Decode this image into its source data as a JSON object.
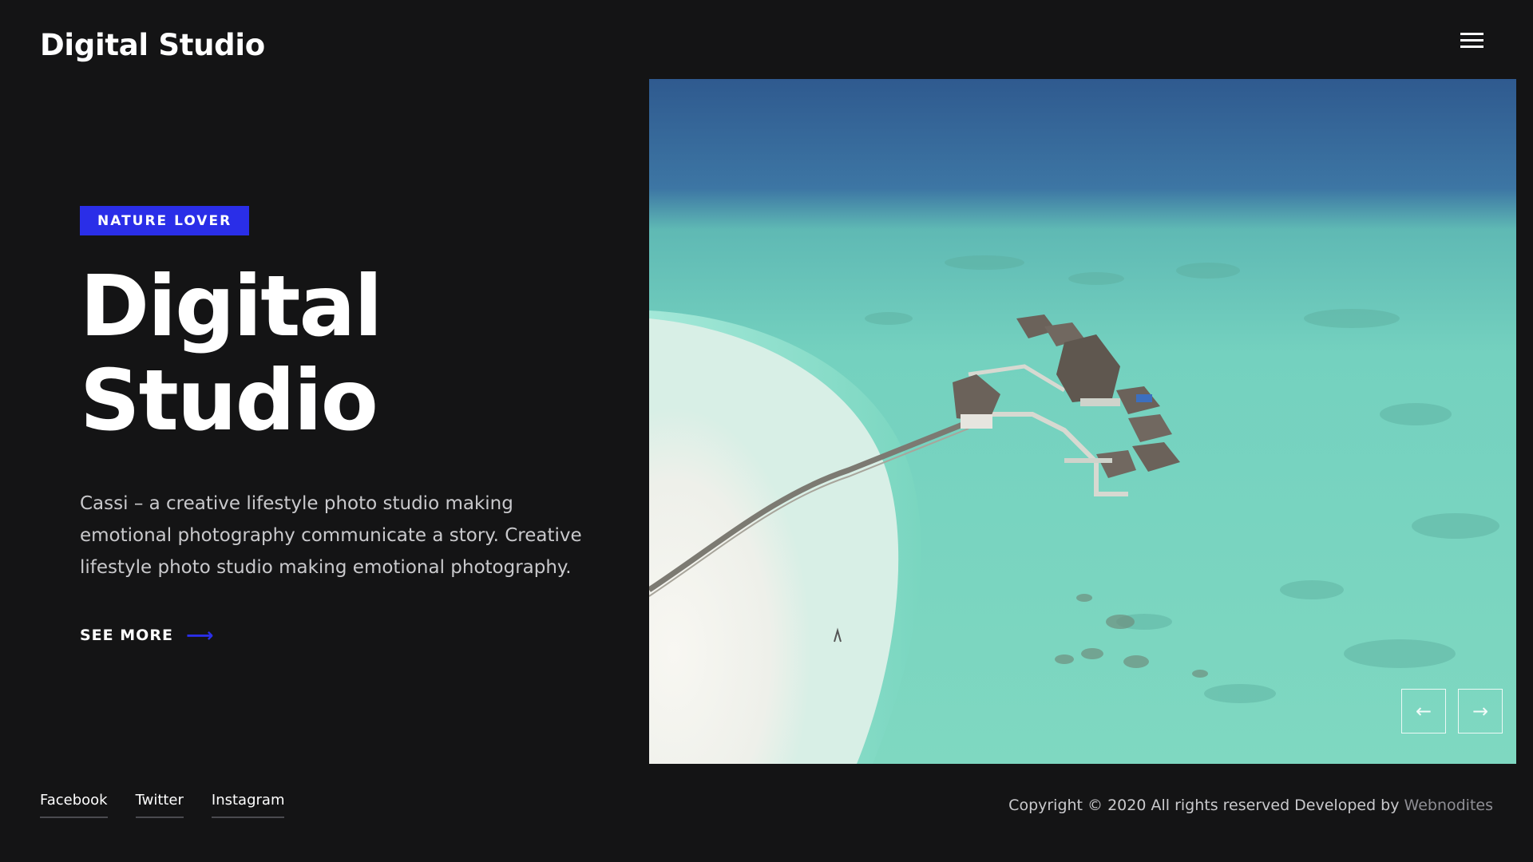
{
  "header": {
    "site_title": "Digital Studio",
    "menu_icon": "hamburger-menu-icon"
  },
  "hero": {
    "tag": "NATURE LOVER",
    "heading_line1": "Digital",
    "heading_line2": "Studio",
    "description": "Cassi – a creative lifestyle photo studio making emotional photography communicate a story. Creative lifestyle photo studio making emotional photography.",
    "cta_label": "SEE MORE",
    "cta_icon": "arrow-right-icon"
  },
  "slider": {
    "image": "aerial-overwater-villas-photo",
    "prev_icon": "arrow-left-icon",
    "next_icon": "arrow-right-icon",
    "prev_glyph": "←",
    "next_glyph": "→"
  },
  "footer": {
    "social": [
      {
        "label": "Facebook"
      },
      {
        "label": "Twitter"
      },
      {
        "label": "Instagram"
      }
    ],
    "copyright_text": "Copyright © 2020 All rights reserved Developed by ",
    "developer": "Webnodites"
  },
  "colors": {
    "background": "#141415",
    "accent": "#2a2ee8",
    "text_muted": "#c9c9cc"
  }
}
